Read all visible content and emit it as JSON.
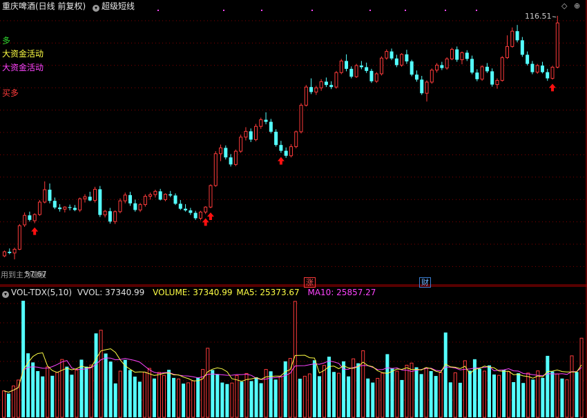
{
  "header": {
    "title": "重庆啤酒(日线 前复权)",
    "indicator": "超级短线"
  },
  "colors": {
    "up": "#ff3b3b",
    "down": "#54ffff",
    "ma5": "#ffff44",
    "ma10": "#ff44ff",
    "grid": "#8a0000",
    "arrow": "#ff1010"
  },
  "signals": {
    "duo": "多",
    "big_money_1": "大资金活动",
    "big_money_2": "大资金活动",
    "buy": "买多"
  },
  "markers": {
    "zhang": "涨",
    "cai": "财"
  },
  "bottom_note": "用到主力选股",
  "vol_header": {
    "name": "VOL-TDX(5,10)",
    "vvol": "VVOL: 37340.99",
    "volume": "VOLUME: 37340.99",
    "ma5": "MA5: 25373.67",
    "ma10": "MA10: 25857.27"
  },
  "chart_data": [
    {
      "type": "candlestick",
      "title": "重庆啤酒(日线 前复权)",
      "high_label": "116.51",
      "low_label": "57.67",
      "ylim": [
        55,
        118
      ],
      "ohlc": [
        [
          58.5,
          59.8,
          58.2,
          59.5
        ],
        [
          59.5,
          60.3,
          58.9,
          59.2
        ],
        [
          59.2,
          60.5,
          57.67,
          60.1
        ],
        [
          60.1,
          66.2,
          59.9,
          65.8
        ],
        [
          66.0,
          69.0,
          65.5,
          68.3
        ],
        [
          68.3,
          69.2,
          66.8,
          67.2
        ],
        [
          67.0,
          68.8,
          66.4,
          68.5
        ],
        [
          68.5,
          72.0,
          68.2,
          71.5
        ],
        [
          71.5,
          76.5,
          71.2,
          74.5
        ],
        [
          74.5,
          76.0,
          71.2,
          71.8
        ],
        [
          71.8,
          72.6,
          69.8,
          70.2
        ],
        [
          70.2,
          71.0,
          69.2,
          69.8
        ],
        [
          69.8,
          70.5,
          69.0,
          70.3
        ],
        [
          70.3,
          70.9,
          69.5,
          70.1
        ],
        [
          70.1,
          70.8,
          69.3,
          69.6
        ],
        [
          69.6,
          72.6,
          69.1,
          72.3
        ],
        [
          72.3,
          73.4,
          71.4,
          72.8
        ],
        [
          72.8,
          74.0,
          71.7,
          71.9
        ],
        [
          71.9,
          75.2,
          71.4,
          74.6
        ],
        [
          74.6,
          75.4,
          67.9,
          68.4
        ],
        [
          68.4,
          69.6,
          67.8,
          69.3
        ],
        [
          69.3,
          70.1,
          66.3,
          66.8
        ],
        [
          66.8,
          69.5,
          66.2,
          69.2
        ],
        [
          69.2,
          72.4,
          68.8,
          71.8
        ],
        [
          71.8,
          73.8,
          71.2,
          73.2
        ],
        [
          73.2,
          74.0,
          70.6,
          71.2
        ],
        [
          71.2,
          72.1,
          69.2,
          69.6
        ],
        [
          69.6,
          71.3,
          69.1,
          70.9
        ],
        [
          70.9,
          73.4,
          70.4,
          72.9
        ],
        [
          72.9,
          73.8,
          72.1,
          73.3
        ],
        [
          73.3,
          74.5,
          72.6,
          74.1
        ],
        [
          74.1,
          74.7,
          71.9,
          72.1
        ],
        [
          72.1,
          73.6,
          71.7,
          73.4
        ],
        [
          73.4,
          74.2,
          72.7,
          73.1
        ],
        [
          73.1,
          73.6,
          70.8,
          71.1
        ],
        [
          71.1,
          72.0,
          69.6,
          69.9
        ],
        [
          69.9,
          71.0,
          69.2,
          69.5
        ],
        [
          69.5,
          70.1,
          68.4,
          68.9
        ],
        [
          68.9,
          69.4,
          67.2,
          67.6
        ],
        [
          67.6,
          69.4,
          67.1,
          69.1
        ],
        [
          69.1,
          70.5,
          68.6,
          70.3
        ],
        [
          70.3,
          75.8,
          70.0,
          75.5
        ],
        [
          75.5,
          83.8,
          75.2,
          83.2
        ],
        [
          83.2,
          85.4,
          81.4,
          84.6
        ],
        [
          84.6,
          85.2,
          81.8,
          82.3
        ],
        [
          82.3,
          83.1,
          80.1,
          80.6
        ],
        [
          80.6,
          84.2,
          80.2,
          83.8
        ],
        [
          83.8,
          87.8,
          83.4,
          87.2
        ],
        [
          87.2,
          89.6,
          86.4,
          88.6
        ],
        [
          88.6,
          89.3,
          86.0,
          86.6
        ],
        [
          86.6,
          90.4,
          86.2,
          89.8
        ],
        [
          89.8,
          91.9,
          89.2,
          91.4
        ],
        [
          91.4,
          93.2,
          90.3,
          90.9
        ],
        [
          90.9,
          91.6,
          88.1,
          88.5
        ],
        [
          88.5,
          89.1,
          84.9,
          85.3
        ],
        [
          85.3,
          86.3,
          83.4,
          83.9
        ],
        [
          83.9,
          84.7,
          82.2,
          82.7
        ],
        [
          82.7,
          85.5,
          82.3,
          84.9
        ],
        [
          84.9,
          88.8,
          84.5,
          88.5
        ],
        [
          88.5,
          95.4,
          88.1,
          94.9
        ],
        [
          94.9,
          99.8,
          94.6,
          99.3
        ],
        [
          99.3,
          101.4,
          97.6,
          98.1
        ],
        [
          98.1,
          99.6,
          97.4,
          99.1
        ],
        [
          99.1,
          101.2,
          98.4,
          100.6
        ],
        [
          100.6,
          101.6,
          99.3,
          99.8
        ],
        [
          99.8,
          100.7,
          98.8,
          99.3
        ],
        [
          99.3,
          103.2,
          98.9,
          102.8
        ],
        [
          102.8,
          106.1,
          102.4,
          105.6
        ],
        [
          105.6,
          107.2,
          103.1,
          103.7
        ],
        [
          103.7,
          104.3,
          101.4,
          101.8
        ],
        [
          101.8,
          104.9,
          101.5,
          104.5
        ],
        [
          104.5,
          105.6,
          103.6,
          104.1
        ],
        [
          104.1,
          105.2,
          102.7,
          103.2
        ],
        [
          103.2,
          103.7,
          100.3,
          100.7
        ],
        [
          100.7,
          102.9,
          100.3,
          102.5
        ],
        [
          102.5,
          106.7,
          102.1,
          106.3
        ],
        [
          106.3,
          108.4,
          105.9,
          107.9
        ],
        [
          107.9,
          108.6,
          105.8,
          106.2
        ],
        [
          106.2,
          107.1,
          104.1,
          104.6
        ],
        [
          104.6,
          107.5,
          104.2,
          107.2
        ],
        [
          107.2,
          108.3,
          104.9,
          105.5
        ],
        [
          105.5,
          105.9,
          101.9,
          102.3
        ],
        [
          102.3,
          103.3,
          100.6,
          101.1
        ],
        [
          101.1,
          102.0,
          97.4,
          97.8
        ],
        [
          97.8,
          100.9,
          95.8,
          100.5
        ],
        [
          100.5,
          103.8,
          100.1,
          103.4
        ],
        [
          103.4,
          105.1,
          102.8,
          104.6
        ],
        [
          104.6,
          105.4,
          103.4,
          103.9
        ],
        [
          103.9,
          106.5,
          103.5,
          106.1
        ],
        [
          106.1,
          108.8,
          105.8,
          108.4
        ],
        [
          108.4,
          109.1,
          105.4,
          105.9
        ],
        [
          105.9,
          107.9,
          104.8,
          107.6
        ],
        [
          107.6,
          108.2,
          105.6,
          106.1
        ],
        [
          106.1,
          106.9,
          102.4,
          102.8
        ],
        [
          102.8,
          103.6,
          100.7,
          101.2
        ],
        [
          101.2,
          104.6,
          100.8,
          104.2
        ],
        [
          104.2,
          105.1,
          102.7,
          103.1
        ],
        [
          103.1,
          103.8,
          99.4,
          99.9
        ],
        [
          99.9,
          101.4,
          98.9,
          100.9
        ],
        [
          100.9,
          106.8,
          100.6,
          106.4
        ],
        [
          106.4,
          111.8,
          106.1,
          109.1
        ],
        [
          109.1,
          113.7,
          108.8,
          112.8
        ],
        [
          112.8,
          114.3,
          110.1,
          110.6
        ],
        [
          110.6,
          111.4,
          106.6,
          107.1
        ],
        [
          107.1,
          107.9,
          104.5,
          104.9
        ],
        [
          104.9,
          105.6,
          102.4,
          102.9
        ],
        [
          102.9,
          104.9,
          102.5,
          104.5
        ],
        [
          104.5,
          105.4,
          102.6,
          102.9
        ],
        [
          102.9,
          103.7,
          100.8,
          101.4
        ],
        [
          101.4,
          104.4,
          101.1,
          104.1
        ],
        [
          104.1,
          116.51,
          103.8,
          114.8
        ]
      ],
      "buy_signals": [
        6,
        41,
        40,
        55,
        109
      ]
    },
    {
      "type": "bar",
      "title": "VOL-TDX(5,10)",
      "ylim": [
        0,
        55000
      ],
      "values": [
        12500,
        11200,
        14800,
        17600,
        55000,
        30200,
        25900,
        21800,
        19300,
        23800,
        19600,
        21200,
        27300,
        23900,
        20100,
        22300,
        27200,
        23900,
        24700,
        39600,
        41100,
        30100,
        26300,
        16000,
        21800,
        27100,
        22300,
        19200,
        16800,
        21300,
        23100,
        18300,
        21200,
        19800,
        22400,
        18600,
        18100,
        15900,
        16300,
        17200,
        18800,
        22600,
        32600,
        22300,
        20400,
        16400,
        15700,
        16200,
        19700,
        16800,
        20700,
        17100,
        18900,
        16100,
        22600,
        21700,
        17800,
        19100,
        26400,
        27800,
        54700,
        18200,
        19400,
        20500,
        26900,
        19400,
        24500,
        28600,
        21400,
        20800,
        26400,
        19300,
        27600,
        25500,
        31400,
        18300,
        16400,
        18400,
        20800,
        29800,
        23100,
        21800,
        17600,
        24600,
        25600,
        23600,
        20400,
        23300,
        21800,
        19500,
        21100,
        40000,
        16500,
        21000,
        16300,
        26700,
        22000,
        27400,
        22900,
        21800,
        24500,
        20200,
        19800,
        22400,
        21600,
        16600,
        20800,
        16200,
        20900,
        17800,
        21900,
        18600,
        29000,
        21600,
        20500,
        18300,
        17700,
        29000,
        21400,
        37340.99
      ],
      "series": [
        {
          "name": "VOLUME",
          "current": 37340.99
        },
        {
          "name": "MA5",
          "current": 25373.67
        },
        {
          "name": "MA10",
          "current": 25857.27
        }
      ]
    }
  ]
}
